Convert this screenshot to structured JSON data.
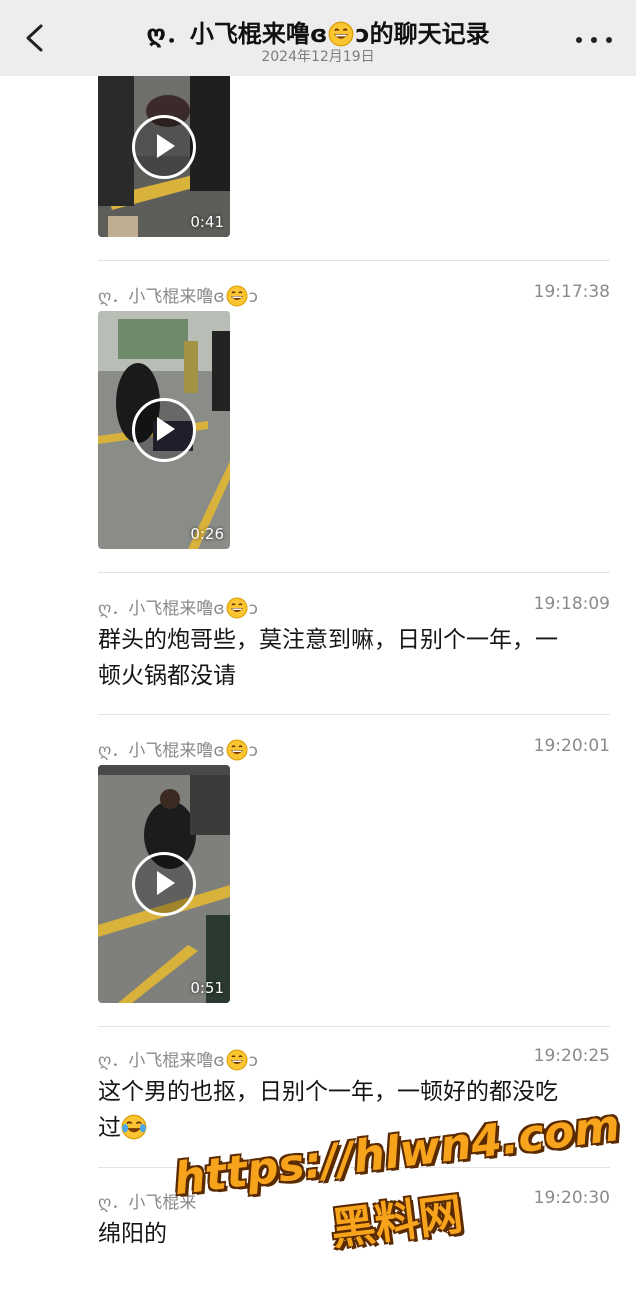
{
  "header": {
    "title_prefix": "ღ．小飞棍来噜ɞ",
    "title_suffix": "ɔ的聊天记录",
    "date": "2024年12月19日",
    "back_icon": "chevron-left-icon",
    "more_icon": "more-dots-icon",
    "background": "#ededed"
  },
  "messages": [
    {
      "type": "video",
      "duration": "0:41"
    },
    {
      "sender_prefix": "ღ．小飞棍来噜ɞ",
      "sender_suffix": "ɔ",
      "time": "19:17:38",
      "type": "video",
      "duration": "0:26"
    },
    {
      "sender_prefix": "ღ．小飞棍来噜ɞ",
      "sender_suffix": "ɔ",
      "time": "19:18:09",
      "type": "text",
      "text_line1": "群头的炮哥些，莫注意到嘛，日别个一年，一",
      "text_line2": "顿火锅都没请"
    },
    {
      "sender_prefix": "ღ．小飞棍来噜ɞ",
      "sender_suffix": "ɔ",
      "time": "19:20:01",
      "type": "video",
      "duration": "0:51"
    },
    {
      "sender_prefix": "ღ．小飞棍来噜ɞ",
      "sender_suffix": "ɔ",
      "time": "19:20:25",
      "type": "text",
      "text_line1": "这个男的也抠，日别个一年，一顿好的都没吃",
      "text_line2": "过"
    },
    {
      "sender_prefix": "ღ．小飞棍来",
      "time": "19:20:30",
      "type": "text",
      "text_line1": "绵阳的"
    }
  ],
  "watermark": {
    "url": "https://hlwn4.com",
    "name": "黑料网",
    "color": "#f7a31b"
  },
  "emoji": {
    "grin": "grinning-face-icon",
    "tears": "crying-laughing-face-icon"
  }
}
